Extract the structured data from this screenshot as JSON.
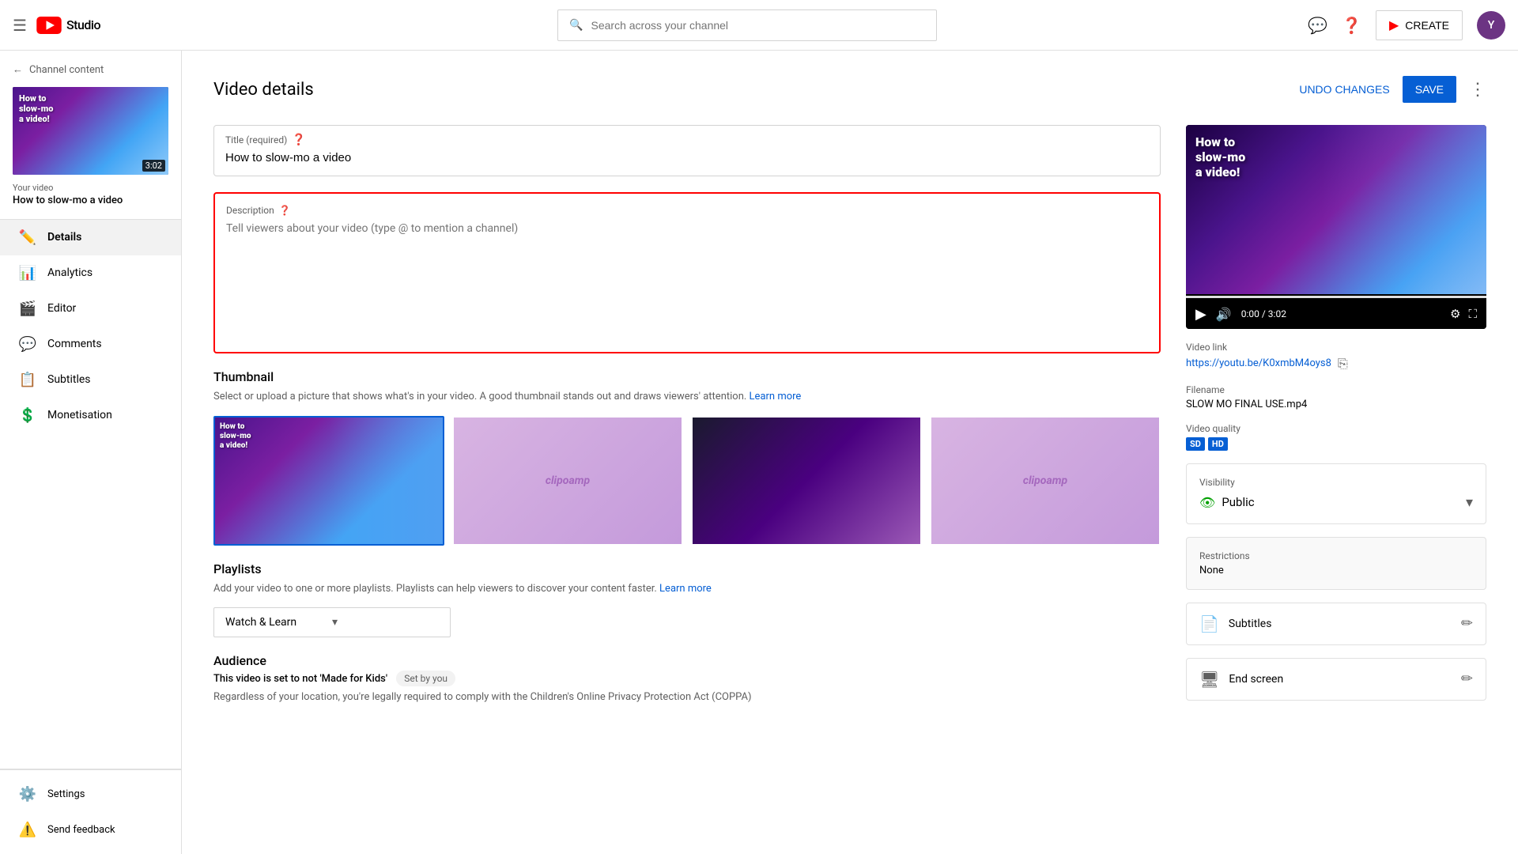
{
  "header": {
    "menu_icon": "☰",
    "logo_text": "Studio",
    "search_placeholder": "Search across your channel",
    "create_label": "CREATE",
    "create_icon": "➕"
  },
  "sidebar": {
    "back_label": "Channel content",
    "video_label": "Your video",
    "video_title": "How to slow-mo a video",
    "video_duration": "3:02",
    "thumb_line1": "How to",
    "thumb_line2": "slow-mo",
    "thumb_line3": "a video!",
    "nav_items": [
      {
        "id": "details",
        "label": "Details",
        "icon": "✏️",
        "active": true
      },
      {
        "id": "analytics",
        "label": "Analytics",
        "icon": "📊",
        "active": false
      },
      {
        "id": "editor",
        "label": "Editor",
        "icon": "🎬",
        "active": false
      },
      {
        "id": "comments",
        "label": "Comments",
        "icon": "💬",
        "active": false
      },
      {
        "id": "subtitles",
        "label": "Subtitles",
        "icon": "📋",
        "active": false
      },
      {
        "id": "monetisation",
        "label": "Monetisation",
        "icon": "💲",
        "active": false
      }
    ],
    "bottom_items": [
      {
        "id": "settings",
        "label": "Settings",
        "icon": "⚙️"
      },
      {
        "id": "feedback",
        "label": "Send feedback",
        "icon": "⚠️"
      }
    ]
  },
  "page": {
    "title": "Video details",
    "undo_label": "UNDO CHANGES",
    "save_label": "SAVE"
  },
  "form": {
    "title_label": "Title (required)",
    "title_value": "How to slow-mo a video",
    "description_label": "Description",
    "description_placeholder": "Tell viewers about your video (type @ to mention a channel)",
    "thumbnail_section_title": "Thumbnail",
    "thumbnail_section_desc": "Select or upload a picture that shows what's in your video. A good thumbnail stands out and draws viewers' attention.",
    "thumbnail_learn_more": "Learn more",
    "playlists_title": "Playlists",
    "playlists_desc": "Add your video to one or more playlists. Playlists can help viewers to discover your content faster.",
    "playlists_learn_more": "Learn more",
    "playlist_selected": "Watch & Learn",
    "audience_title": "Audience",
    "audience_note": "This video is set to not 'Made for Kids'",
    "audience_set_by": "Set by you",
    "audience_desc": "Regardless of your location, you're legally required to comply with the Children's Online Privacy Protection Act (COPPA)"
  },
  "right_panel": {
    "video_link_label": "Video link",
    "video_link": "https://youtu.be/K0xmbM4oys8",
    "filename_label": "Filename",
    "filename_value": "SLOW MO FINAL USE.mp4",
    "quality_label": "Video quality",
    "quality_badges": [
      "SD",
      "HD"
    ],
    "time_display": "0:00 / 3:02",
    "visibility_label": "Visibility",
    "visibility_value": "Public",
    "restrictions_label": "Restrictions",
    "restrictions_value": "None",
    "subtitles_label": "Subtitles",
    "end_screen_label": "End screen",
    "thumb_line1": "How to",
    "thumb_line2": "slow-mo",
    "thumb_line3": "a video!"
  }
}
